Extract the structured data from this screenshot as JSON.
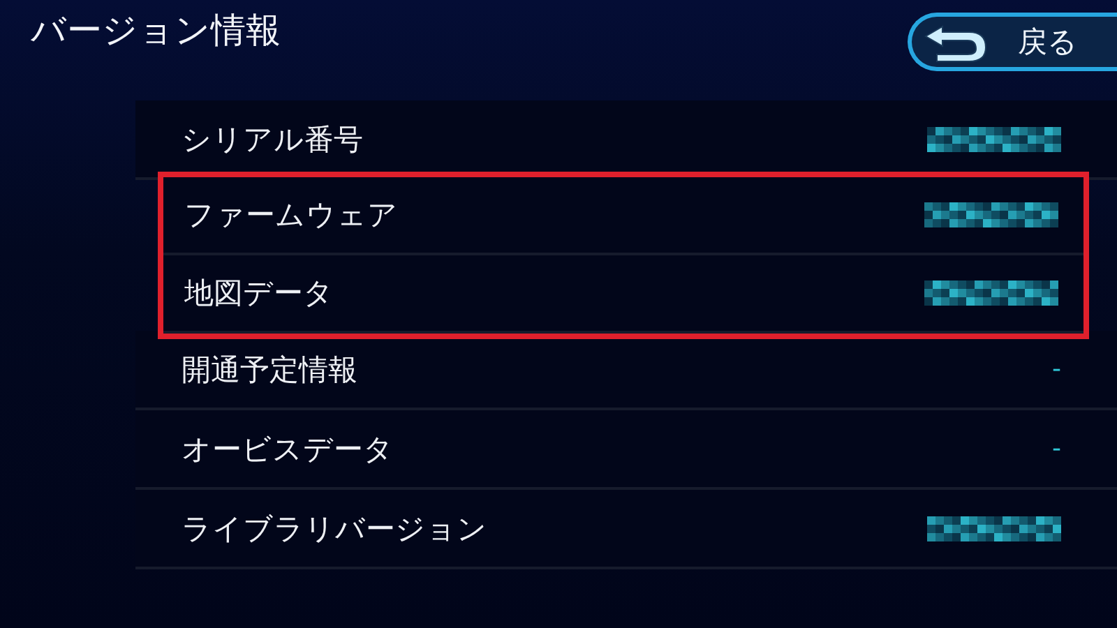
{
  "header": {
    "title": "バージョン情報",
    "back_button": {
      "label": "戻る"
    }
  },
  "rows": [
    {
      "label": "シリアル番号",
      "value": {
        "kind": "mosaic"
      },
      "highlighted": false
    },
    {
      "label": "ファームウェア",
      "value": {
        "kind": "mosaic"
      },
      "highlighted": true
    },
    {
      "label": "地図データ",
      "value": {
        "kind": "mosaic"
      },
      "highlighted": true
    },
    {
      "label": "開通予定情報",
      "value": {
        "kind": "text",
        "text": "-"
      },
      "highlighted": false
    },
    {
      "label": "オービスデータ",
      "value": {
        "kind": "text",
        "text": "-"
      },
      "highlighted": false
    },
    {
      "label": "ライブラリバージョン",
      "value": {
        "kind": "mosaic"
      },
      "highlighted": false
    }
  ]
}
